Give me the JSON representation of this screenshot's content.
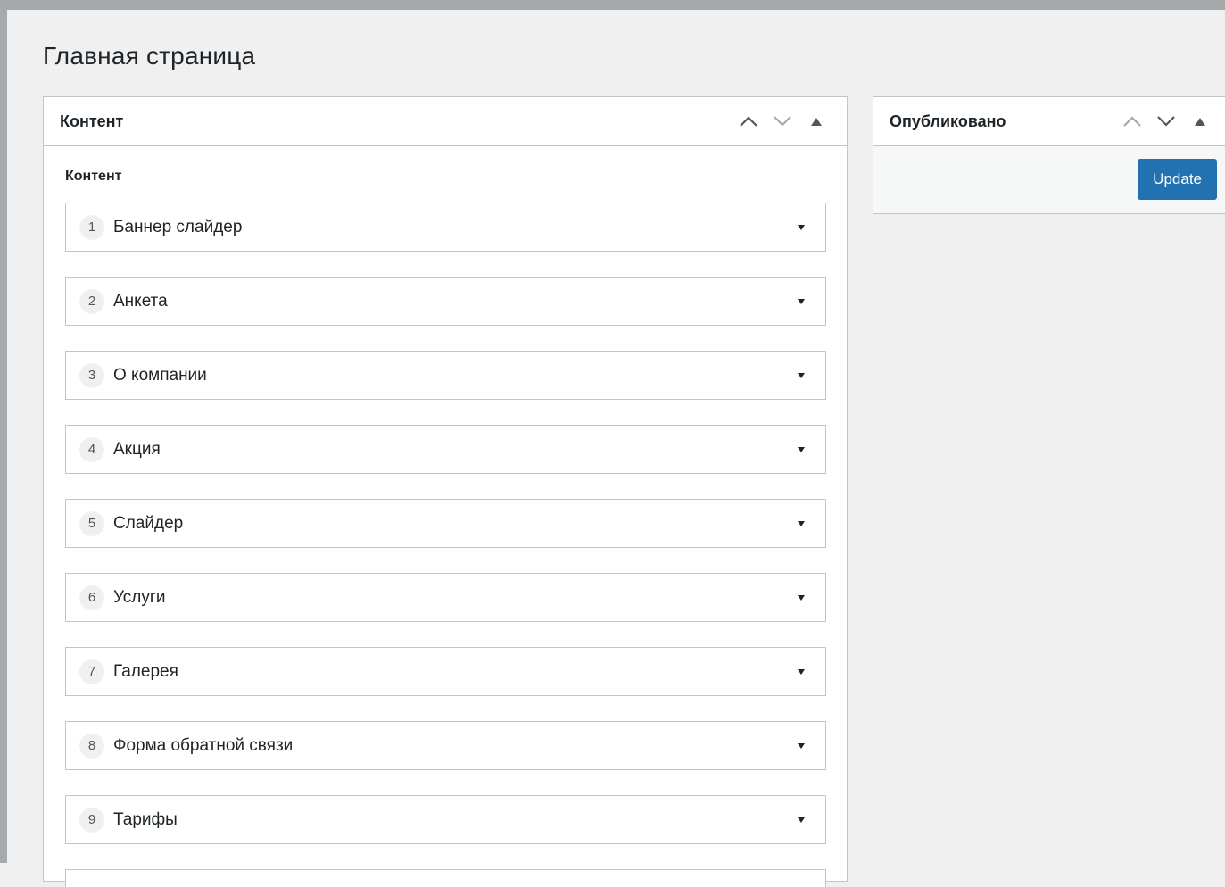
{
  "page": {
    "title": "Главная страница"
  },
  "content_box": {
    "title": "Контент",
    "field_label": "Контент",
    "layouts": [
      {
        "index": "1",
        "label": "Баннер слайдер"
      },
      {
        "index": "2",
        "label": "Анкета"
      },
      {
        "index": "3",
        "label": "О компании"
      },
      {
        "index": "4",
        "label": "Акция"
      },
      {
        "index": "5",
        "label": "Слайдер"
      },
      {
        "index": "6",
        "label": "Услуги"
      },
      {
        "index": "7",
        "label": "Галерея"
      },
      {
        "index": "8",
        "label": "Форма обратной связи"
      },
      {
        "index": "9",
        "label": "Тарифы"
      }
    ]
  },
  "publish_box": {
    "title": "Опубликовано",
    "update_label": "Update"
  },
  "icons": {
    "move_up": "chevron-up-icon",
    "move_down": "chevron-down-icon",
    "toggle": "triangle-up-icon",
    "layout_toggle": "caret-down-icon"
  },
  "colors": {
    "primary_button": "#2271b1",
    "background": "#f0f0f1",
    "border": "#c3c4c7"
  }
}
